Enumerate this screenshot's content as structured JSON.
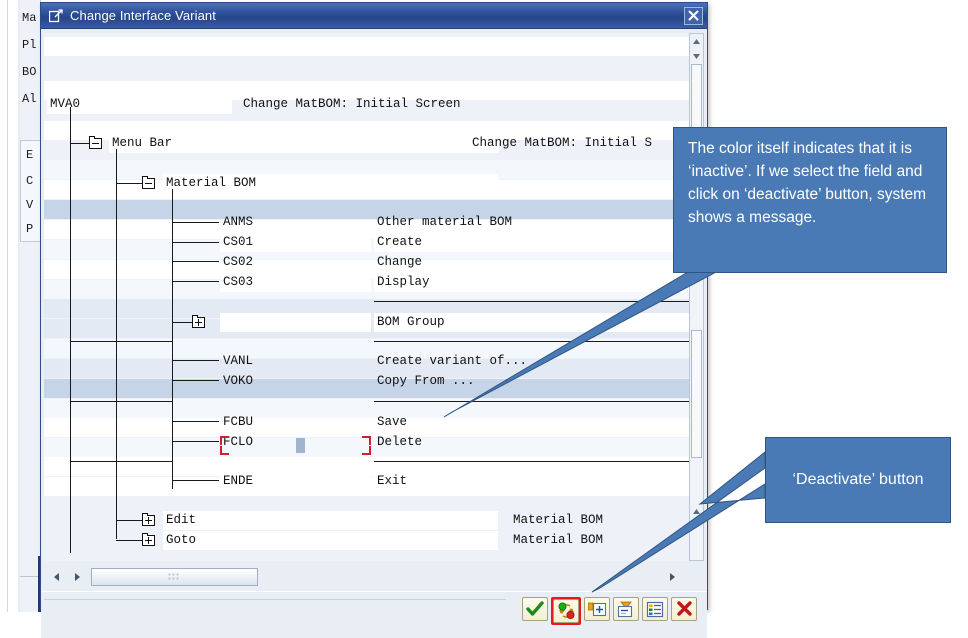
{
  "background_window": {
    "field_labels": [
      "Ma",
      "Pl",
      "BO",
      "Al"
    ],
    "sub_labels": [
      "E",
      "C",
      "V",
      "P"
    ]
  },
  "dialog": {
    "title": "Change Interface Variant",
    "title_icon": "variant-window-icon",
    "close_icon": "close-icon",
    "variant_id": "MVA0",
    "variant_description": "Change MatBOM: Initial Screen",
    "rows": [
      {
        "node": "none",
        "key": "",
        "text": "",
        "right": "",
        "band": "white",
        "sep_above": false
      },
      {
        "node": "minus",
        "key": "",
        "text": "Menu Bar",
        "right": "Change MatBOM: Initial S",
        "band": "white",
        "sep_above": false
      },
      {
        "node": "minus",
        "key": "",
        "text": "Material BOM",
        "right": "",
        "band": "white",
        "sep_above": false
      },
      {
        "node": "leaf",
        "key": "ANMS",
        "text": "Other material BOM",
        "right": "",
        "band": "light",
        "sep_above": false
      },
      {
        "node": "leaf",
        "key": "CS01",
        "text": "Create",
        "right": "",
        "band": "white",
        "sep_above": false
      },
      {
        "node": "leaf",
        "key": "CS02",
        "text": "Change",
        "right": "",
        "band": "select",
        "sep_above": false
      },
      {
        "node": "leaf",
        "key": "CS03",
        "text": "Display",
        "right": "",
        "band": "white",
        "sep_above": false
      },
      {
        "node": "none",
        "key": "",
        "text": "",
        "right": "",
        "band": "light",
        "sep_above": true
      },
      {
        "node": "plus",
        "key": "",
        "text": "BOM Group",
        "right": "",
        "band": "white",
        "sep_above": false
      },
      {
        "node": "none",
        "key": "",
        "text": "",
        "right": "",
        "band": "light",
        "sep_above": true
      },
      {
        "node": "leaf",
        "key": "VANL",
        "text": "Create variant of...",
        "right": "",
        "band": "band",
        "sep_above": false
      },
      {
        "node": "leaf",
        "key": "VOKO",
        "text": "Copy From ...",
        "right": "",
        "band": "band",
        "sep_above": false
      },
      {
        "node": "none",
        "key": "",
        "text": "",
        "right": "",
        "band": "light",
        "sep_above": true
      },
      {
        "node": "leaf",
        "key": "FCBU",
        "text": "Save",
        "right": "",
        "band": "band",
        "sep_above": false
      },
      {
        "node": "leaf",
        "key": "FCLO",
        "text": "Delete",
        "right": "",
        "band": "select",
        "sep_above": false
      },
      {
        "node": "none",
        "key": "",
        "text": "",
        "right": "",
        "band": "light",
        "sep_above": true
      },
      {
        "node": "leaf",
        "key": "ENDE",
        "text": "Exit",
        "right": "",
        "band": "white",
        "sep_above": false
      },
      {
        "node": "none",
        "key": "",
        "text": "",
        "right": "",
        "band": "light",
        "sep_above": false
      },
      {
        "node": "plus",
        "key": "",
        "text": "Edit",
        "right": "Material BOM",
        "band": "white",
        "sep_above": false
      },
      {
        "node": "plus",
        "key": "",
        "text": "Goto",
        "right": "Material BOM",
        "band": "white",
        "sep_above": false
      }
    ],
    "buttons": [
      {
        "name": "continue-button",
        "icon": "green-check-icon",
        "label": "Continue"
      },
      {
        "name": "deactivate-button",
        "icon": "activate-toggle-icon",
        "label": "Deactivate"
      },
      {
        "name": "insert-button",
        "icon": "insert-node-icon",
        "label": "Insert"
      },
      {
        "name": "remove-button",
        "icon": "remove-node-icon",
        "label": "Remove"
      },
      {
        "name": "details-button",
        "icon": "list-details-icon",
        "label": "Details"
      },
      {
        "name": "cancel-button",
        "icon": "red-x-icon",
        "label": "Cancel"
      }
    ],
    "scrollbar": {
      "up_arrow_icon": "scroll-up-icon",
      "down_arrow_icon": "scroll-down-icon",
      "left_arrow_icon": "scroll-left-icon",
      "right_arrow_icon": "scroll-right-icon",
      "bottom_arrow_icon": "scroll-up-icon"
    }
  },
  "annotations": {
    "callout_1": "The color itself indicates that it is ‘inactive’. If we select the field and click on ‘deactivate’ button, system shows a message.",
    "callout_2": "‘Deactivate’ button",
    "accent_color": "#4a7ab5",
    "highlight_color": "#e8191c"
  }
}
